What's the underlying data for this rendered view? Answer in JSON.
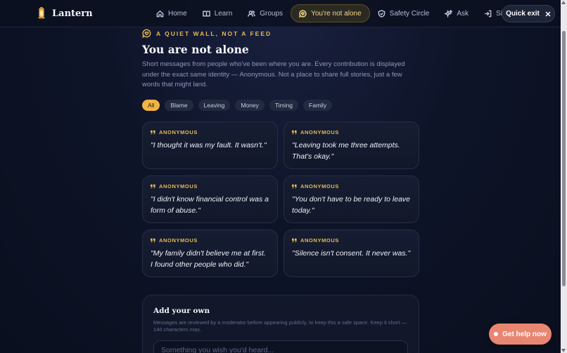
{
  "brand": {
    "name": "Lantern"
  },
  "nav": {
    "items": [
      {
        "label": "Home",
        "icon": "home-icon"
      },
      {
        "label": "Learn",
        "icon": "book-icon"
      },
      {
        "label": "Groups",
        "icon": "users-icon"
      },
      {
        "label": "You're not alone",
        "icon": "chat-heart-icon",
        "active": true
      },
      {
        "label": "Safety Circle",
        "icon": "shield-icon"
      },
      {
        "label": "Ask",
        "icon": "sparkle-icon"
      },
      {
        "label": "Sign-in co",
        "icon": "sign-in-icon"
      }
    ],
    "quick_exit": "Quick exit"
  },
  "page": {
    "eyebrow": "A QUIET WALL, NOT A FEED",
    "title": "You are not alone",
    "description": "Short messages from people who've been where you are. Every contribution is displayed under the exact same identity — Anonymous. Not a place to share full stories, just a few words that might land."
  },
  "filters": [
    "All",
    "Blame",
    "Leaving",
    "Money",
    "Timing",
    "Family"
  ],
  "active_filter": "All",
  "messages": [
    {
      "author": "ANONYMOUS",
      "quote": "\"I thought it was my fault. It wasn't.\""
    },
    {
      "author": "ANONYMOUS",
      "quote": "\"Leaving took me three attempts. That's okay.\""
    },
    {
      "author": "ANONYMOUS",
      "quote": "\"I didn't know financial control was a form of abuse.\""
    },
    {
      "author": "ANONYMOUS",
      "quote": "\"You don't have to be ready to leave today.\""
    },
    {
      "author": "ANONYMOUS",
      "quote": "\"My family didn't believe me at first. I found other people who did.\""
    },
    {
      "author": "ANONYMOUS",
      "quote": "\"Silence isn't consent. It never was.\""
    }
  ],
  "add": {
    "title": "Add your own",
    "description": "Messages are reviewed by a moderator before appearing publicly, to keep this a safe space. Keep it short — 140 characters max.",
    "placeholder": "Something you wish you'd heard..."
  },
  "help_button": "Get help now",
  "colors": {
    "accent": "#f1b545",
    "help": "#e98672",
    "background": "#0e1428"
  }
}
